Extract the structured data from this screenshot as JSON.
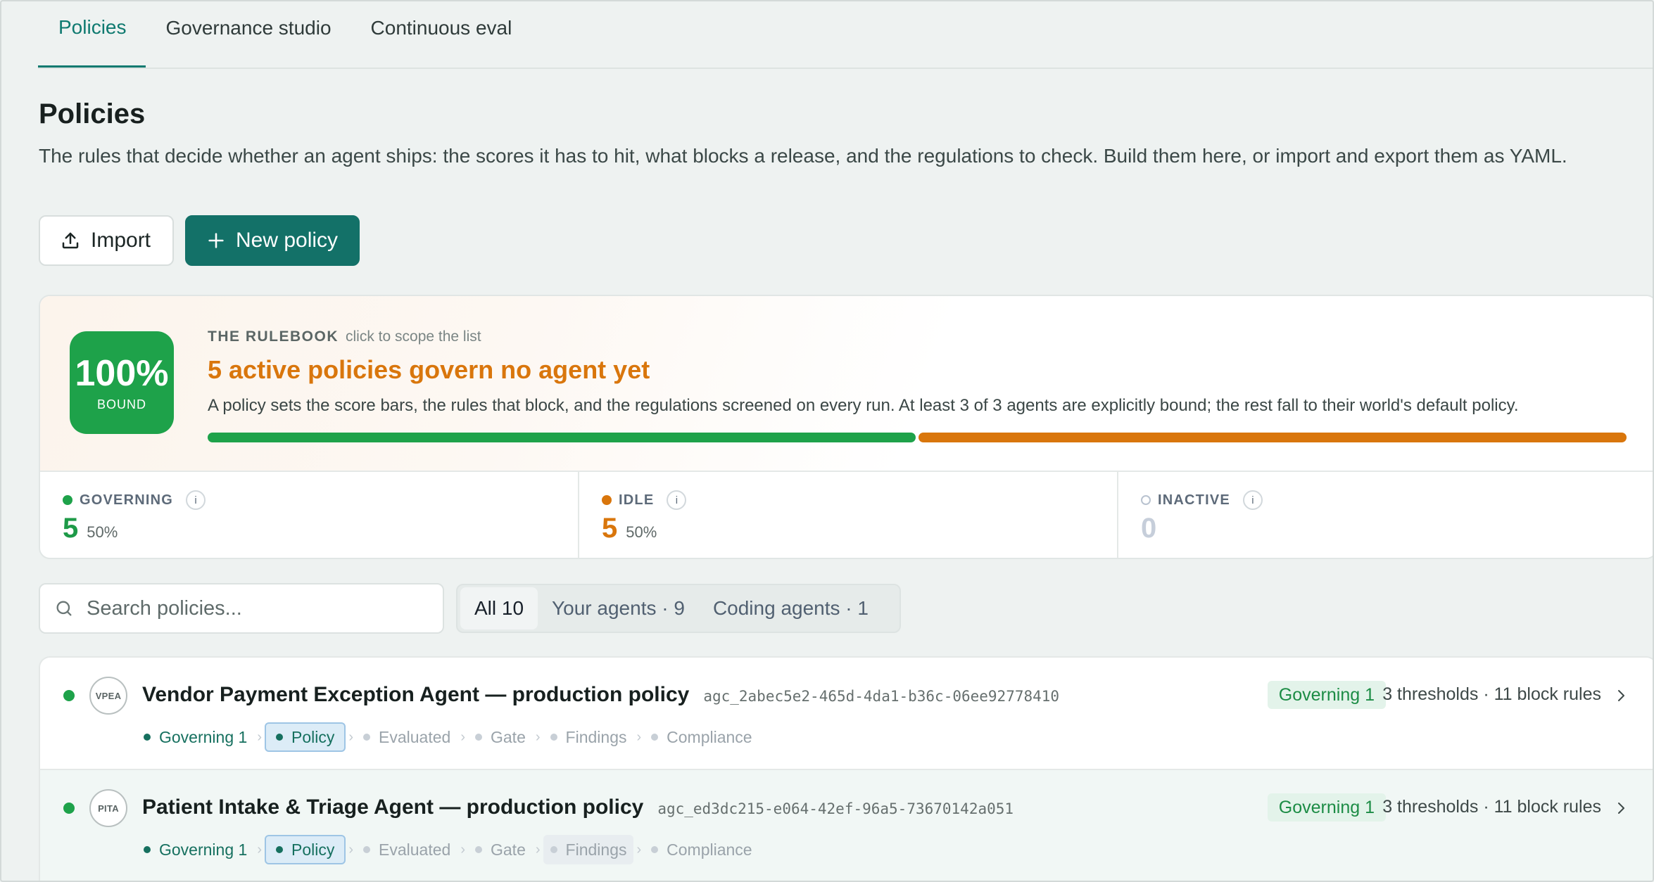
{
  "tabs": [
    {
      "label": "Policies",
      "active": true
    },
    {
      "label": "Governance studio",
      "active": false
    },
    {
      "label": "Continuous eval",
      "active": false
    }
  ],
  "page": {
    "title": "Policies",
    "description": "The rules that decide whether an agent ships: the scores it has to hit, what blocks a release, and the regulations to check. Build them here, or import and export them as YAML."
  },
  "actions": {
    "import_label": "Import",
    "new_label": "New policy",
    "import_icon": "upload-icon",
    "new_icon": "plus-icon"
  },
  "rulebook": {
    "badge_value": "100%",
    "badge_label": "BOUND",
    "kicker": "THE RULEBOOK",
    "kicker_hint": "click to scope the list",
    "headline": "5 active policies govern no agent yet",
    "subtext": "A policy sets the score bars, the rules that block, and the regulations screened on every run. At least 3 of 3 agents are explicitly bound; the rest fall to their world's default policy.",
    "bar": {
      "governing_fraction": 0.5,
      "idle_fraction": 0.5
    },
    "colors": {
      "governing": "#1ea24a",
      "idle": "#d9760c"
    }
  },
  "stats": [
    {
      "label": "GOVERNING",
      "value": "5",
      "pct": "50%"
    },
    {
      "label": "IDLE",
      "value": "5",
      "pct": "50%"
    },
    {
      "label": "INACTIVE",
      "value": "0",
      "pct": ""
    }
  ],
  "search": {
    "placeholder": "Search policies..."
  },
  "filters": [
    {
      "label": "All 10",
      "active": true
    },
    {
      "label": "Your agents · 9",
      "active": false
    },
    {
      "label": "Coding agents · 1",
      "active": false
    }
  ],
  "policies": [
    {
      "avatar": "VPEA",
      "title": "Vendor Payment Exception Agent — production policy",
      "id": "agc_2abec5e2-465d-4da1-b36c-06ee92778410",
      "status": "Governing 1",
      "meta": "3 thresholds · 11 block rules",
      "steps": [
        "Governing 1",
        "Policy",
        "Evaluated",
        "Gate",
        "Findings",
        "Compliance"
      ]
    },
    {
      "avatar": "PITA",
      "title": "Patient Intake & Triage Agent — production policy",
      "id": "agc_ed3dc215-e064-42ef-96a5-73670142a051",
      "status": "Governing 1",
      "meta": "3 thresholds · 11 block rules",
      "steps": [
        "Governing 1",
        "Policy",
        "Evaluated",
        "Gate",
        "Findings",
        "Compliance"
      ]
    }
  ]
}
